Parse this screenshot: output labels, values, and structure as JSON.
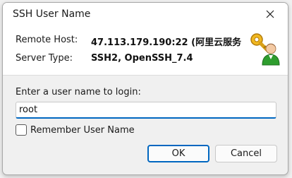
{
  "window": {
    "title": "SSH User Name",
    "close_icon": "close-icon"
  },
  "info": {
    "remote_host_label": "Remote Host:",
    "remote_host_value": "47.113.179.190:22 (阿里云服务",
    "server_type_label": "Server Type:",
    "server_type_value": "SSH2, OpenSSH_7.4",
    "icon": "key-user-icon"
  },
  "form": {
    "prompt": "Enter a user name to login:",
    "username_value": "root",
    "remember_label": "Remember User Name",
    "remember_checked": false
  },
  "buttons": {
    "ok": "OK",
    "cancel": "Cancel"
  },
  "colors": {
    "accent": "#0067c0",
    "background": "#f0f0f0",
    "header_bg": "#ffffff"
  }
}
